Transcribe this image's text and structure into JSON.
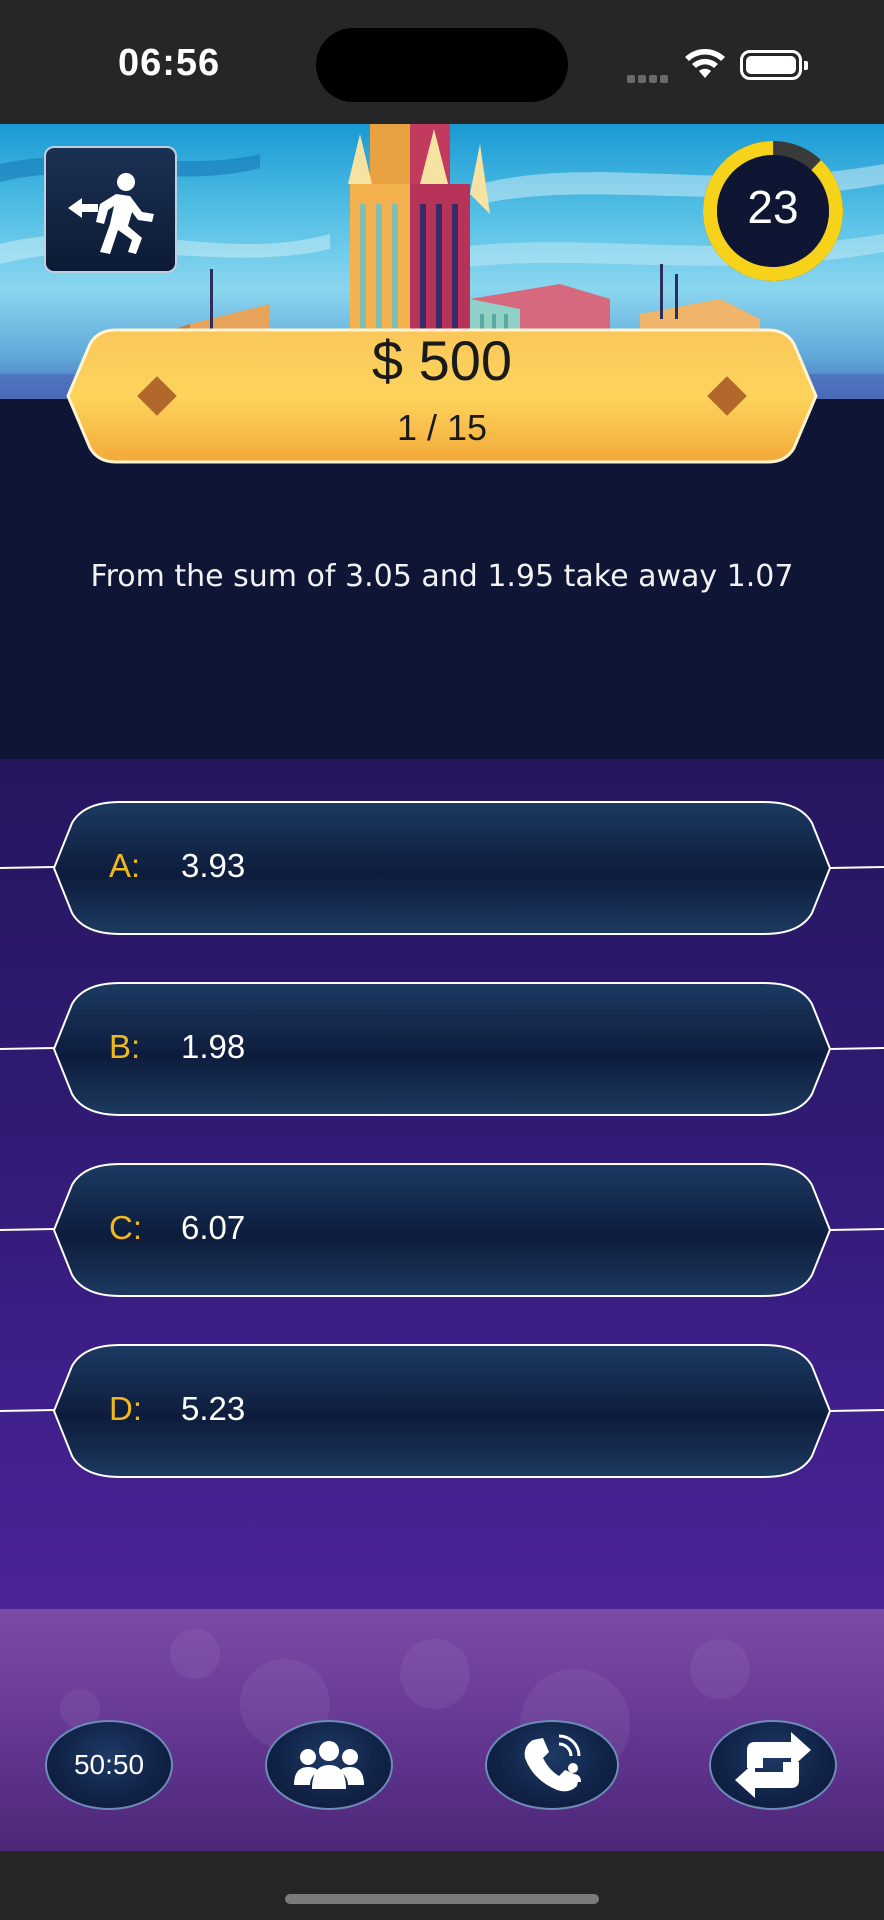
{
  "status_bar": {
    "time": "06:56"
  },
  "timer": {
    "value": "23",
    "progress": 0.88
  },
  "prize": {
    "amount": "$ 500",
    "progress": "1 / 15"
  },
  "question": {
    "text": "From the sum of 3.05 and 1.95 take away 1.07"
  },
  "answers": [
    {
      "letter": "A:",
      "text": "3.93"
    },
    {
      "letter": "B:",
      "text": "1.98"
    },
    {
      "letter": "C:",
      "text": "6.07"
    },
    {
      "letter": "D:",
      "text": "5.23"
    }
  ],
  "lifelines": {
    "fifty_fifty": "50:50"
  },
  "colors": {
    "gold": "#f0b81b",
    "navy": "#0f1535",
    "purple": "#3f1f8a"
  },
  "icons": [
    "exit-icon",
    "audience-icon",
    "phone-a-friend-icon",
    "switch-question-icon"
  ]
}
